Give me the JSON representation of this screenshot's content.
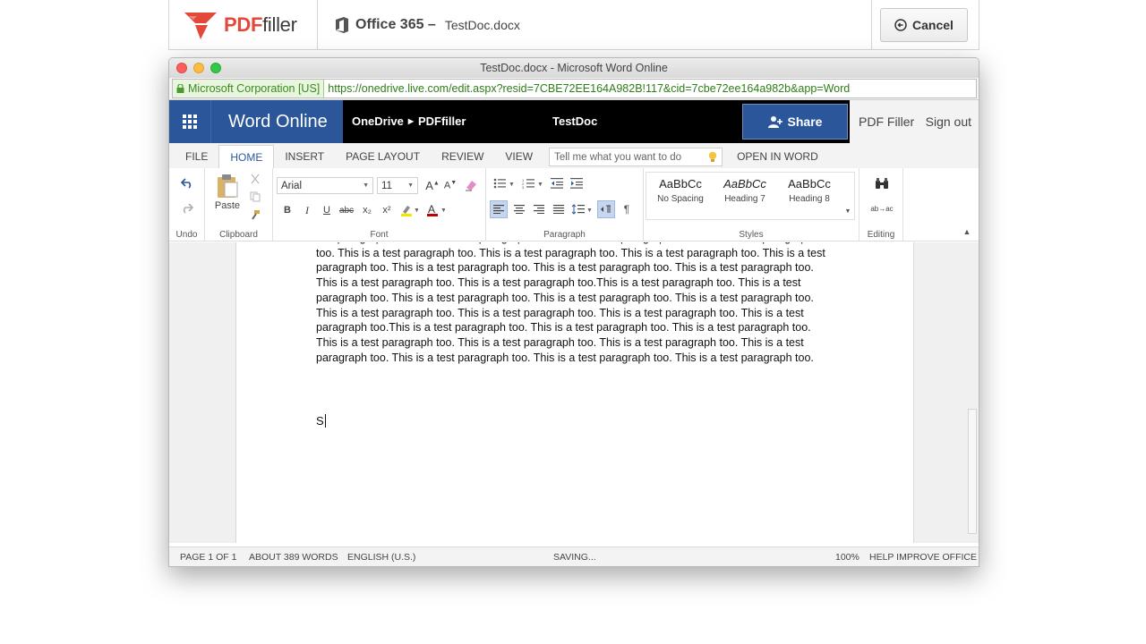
{
  "pdffiller": {
    "logo_main": "PDF",
    "logo_rest": "filler",
    "office_label": "Office 365 –",
    "doc_name": "TestDoc.docx",
    "cancel_label": "Cancel"
  },
  "window": {
    "title": "TestDoc.docx - Microsoft Word Online",
    "ev_label": "Microsoft Corporation [US]",
    "url": "https://onedrive.live.com/edit.aspx?resid=7CBE72EE164A982B!117&cid=7cbe72ee164a982b&app=Word"
  },
  "nav": {
    "app_name": "Word Online",
    "bc_root": "OneDrive",
    "bc_sep": "▶",
    "bc_folder": "PDFfiller",
    "doc_title": "TestDoc",
    "share_label": "Share",
    "pdf_filler_link": "PDF Filler",
    "sign_out": "Sign out"
  },
  "tabs": {
    "file": "FILE",
    "home": "HOME",
    "insert": "INSERT",
    "page_layout": "PAGE LAYOUT",
    "review": "REVIEW",
    "view": "VIEW",
    "tellme_placeholder": "Tell me what you want to do",
    "open_in_word": "OPEN IN WORD"
  },
  "ribbon": {
    "undo_label": "Undo",
    "paste_label": "Paste",
    "clipboard_label": "Clipboard",
    "font_name": "Arial",
    "font_size": "11",
    "font_label": "Font",
    "bold": "B",
    "italic": "I",
    "underline": "U",
    "strike": "abc",
    "subscript": "x₂",
    "superscript": "x²",
    "paragraph_label": "Paragraph",
    "styles": [
      {
        "sample": "AaBbCc",
        "name": "No Spacing"
      },
      {
        "sample": "AaBbCc",
        "name": "Heading 7"
      },
      {
        "sample": "AaBbCc",
        "name": "Heading 8"
      }
    ],
    "styles_label": "Styles",
    "editing_label": "Editing",
    "replace_glyph": "ab→ac"
  },
  "document": {
    "paragraph": "test paragraph too. This is a test paragraph too. This is a test paragraph too. This is a test paragraph too. This is a test paragraph too. This is a test paragraph too. This is a test paragraph too. This is a test paragraph too. This is a test paragraph too. This is a test paragraph too. This is a test paragraph too. This is a test paragraph too. This is a test paragraph too.This is a test paragraph too. This is a test paragraph too. This is a test paragraph too. This is a test paragraph too. This is a test paragraph too. This is a test paragraph too. This is a test paragraph too. This is a test paragraph too. This is a test paragraph too.This is a test paragraph too. This is a test paragraph too. This is a test paragraph too. This is a test paragraph too. This is a test paragraph too. This is a test paragraph too. This is a test paragraph too. This is a test paragraph too. This is a test paragraph too. This is a test paragraph too.",
    "typed_text": "S"
  },
  "status": {
    "page": "PAGE 1 OF 1",
    "words": "ABOUT 389 WORDS",
    "language": "ENGLISH (U.S.)",
    "saving": "SAVING...",
    "zoom": "100%",
    "help": "HELP IMPROVE OFFICE"
  },
  "colors": {
    "word_blue": "#2b579a",
    "pdffiller_red": "#e2493a",
    "ev_green": "#3a8a1e"
  }
}
